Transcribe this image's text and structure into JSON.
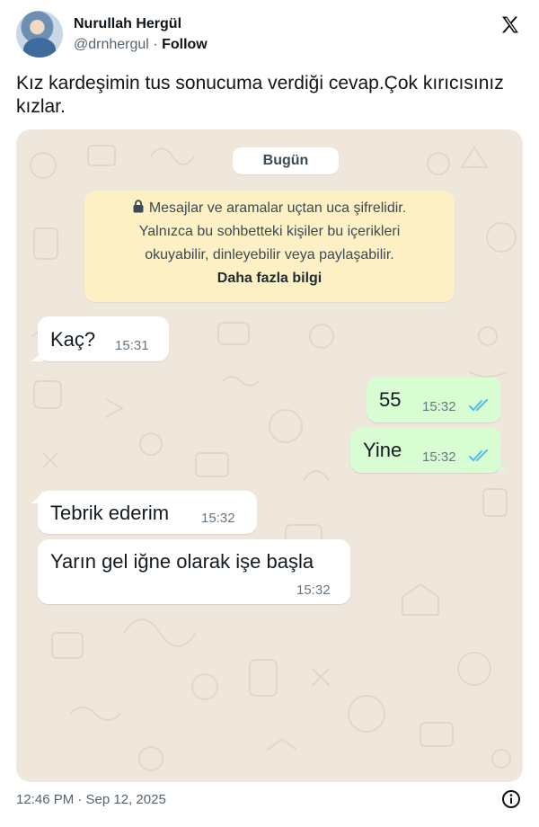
{
  "author": {
    "name": "Nurullah Hergül",
    "handle": "@drnhergul",
    "separator": "·",
    "follow_label": "Follow"
  },
  "tweet": {
    "text": "Kız kardeşimin tus sonucuma verdiği cevap.Çok kırıcısınız kızlar."
  },
  "chat": {
    "date_label": "Bugün",
    "encryption_notice": {
      "line1": "Mesajlar ve aramalar uçtan uca şifrelidir.",
      "line2": "Yalnızca bu sohbetteki kişiler bu içerikleri",
      "line3": "okuyabilir, dinleyebilir veya paylaşabilir.",
      "link": "Daha fazla bilgi"
    },
    "messages": [
      {
        "text": "Kaç?",
        "time": "15:31",
        "direction": "incoming"
      },
      {
        "text": "55",
        "time": "15:32",
        "direction": "outgoing",
        "status": "read"
      },
      {
        "text": "Yine",
        "time": "15:32",
        "direction": "outgoing",
        "status": "read"
      },
      {
        "text": "Tebrik ederim",
        "time": "15:32",
        "direction": "incoming"
      },
      {
        "text": "Yarın gel iğne olarak işe başla",
        "time": "15:32",
        "direction": "incoming"
      }
    ],
    "colors": {
      "wallpaper": "#efe7dc",
      "incoming_bubble": "#ffffff",
      "outgoing_bubble": "#d9fdd3",
      "notice_bg": "#fdf0c4",
      "read_ticks": "#53bdeb"
    }
  },
  "footer": {
    "timestamp": "12:46 PM · Sep 12, 2025"
  },
  "icons": [
    "x-logo-icon",
    "lock-icon",
    "double-check-icon",
    "info-icon"
  ]
}
